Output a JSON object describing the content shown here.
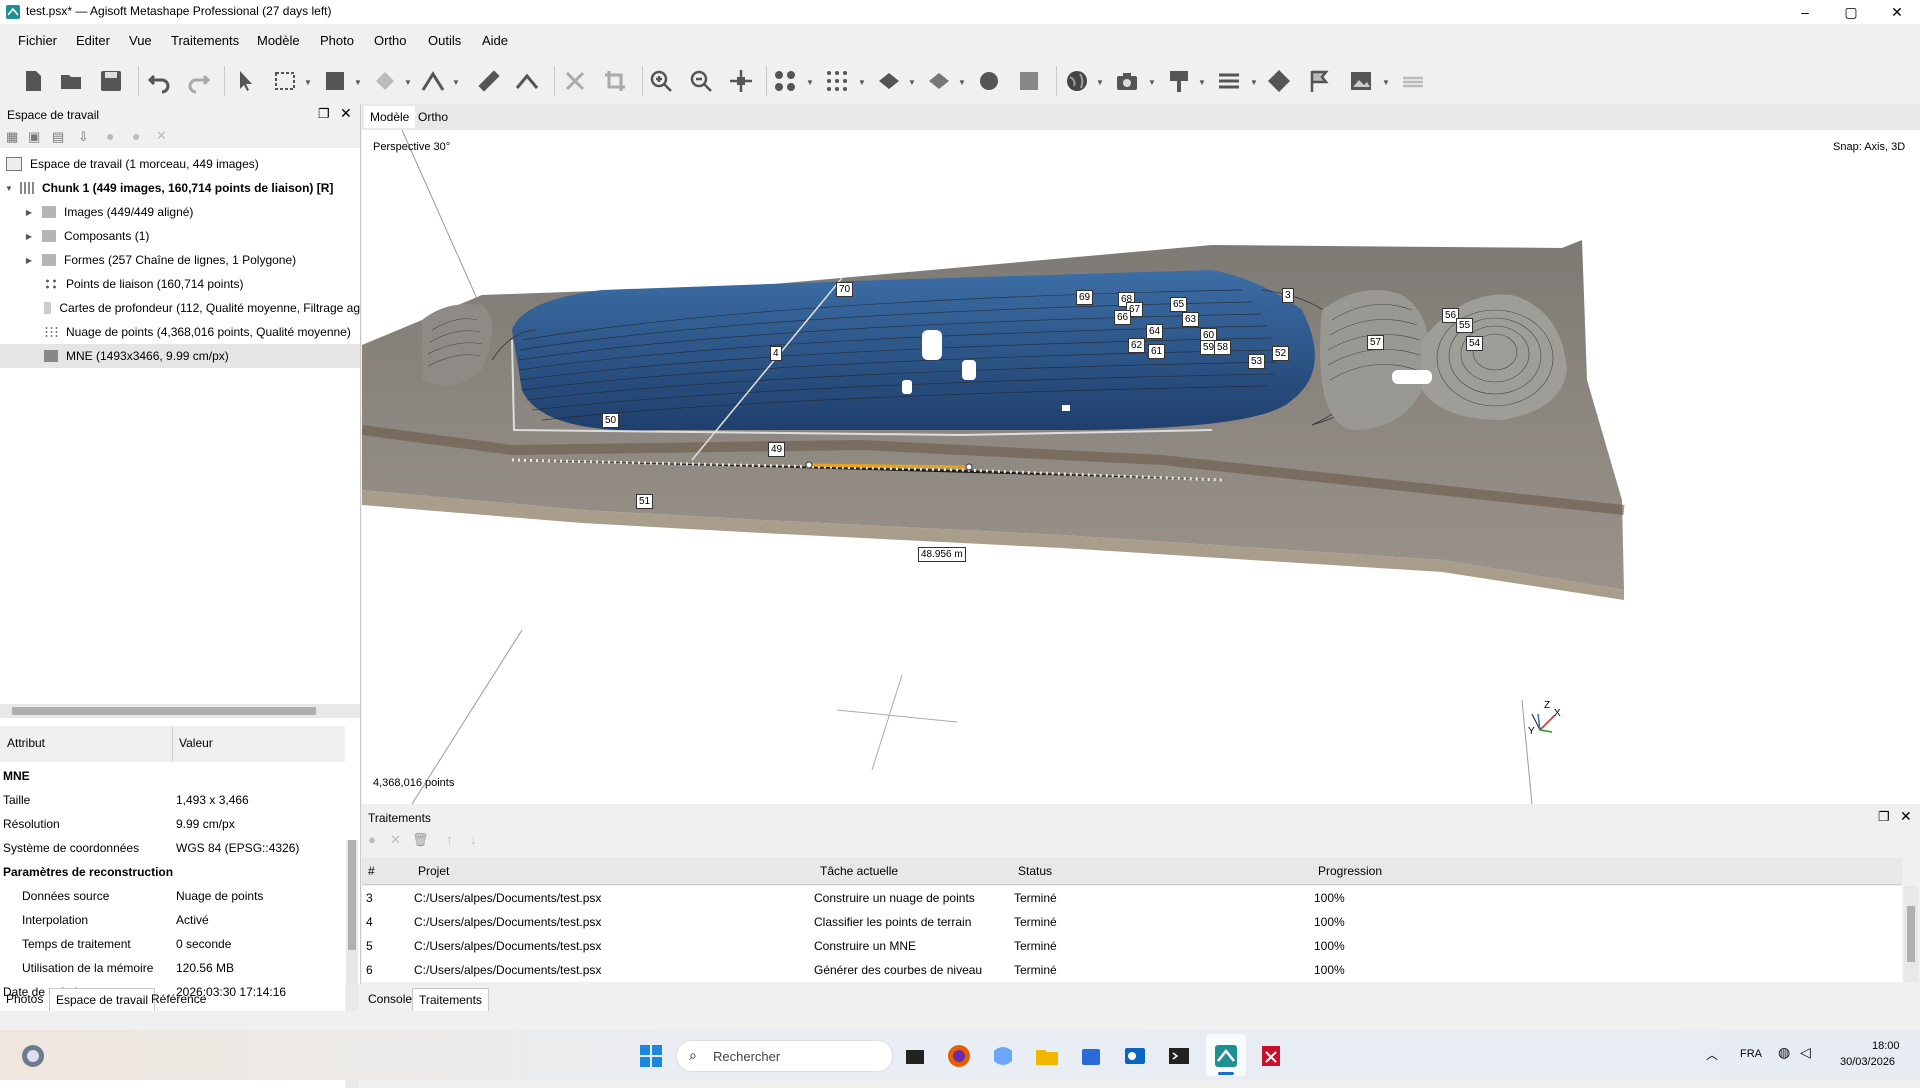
{
  "window": {
    "title": "test.psx* — Agisoft Metashape Professional (27 days left)"
  },
  "menu": [
    "Fichier",
    "Editer",
    "Vue",
    "Traitements",
    "Modèle",
    "Photo",
    "Ortho",
    "Outils",
    "Aide"
  ],
  "workspace": {
    "title": "Espace de travail",
    "root": "Espace de travail (1 morceau, 449 images)",
    "chunk": "Chunk 1 (449 images, 160,714 points de liaison) [R]",
    "items": [
      "Images (449/449 aligné)",
      "Composants (1)",
      "Formes (257 Chaîne de lignes, 1 Polygone)",
      "Points de liaison (160,714 points)",
      "Cartes de profondeur (112, Qualité moyenne, Filtrage ag",
      "Nuage de points (4,368,016 points, Qualité moyenne)",
      "MNE (1493x3466, 9.99 cm/px)"
    ]
  },
  "attributes": {
    "col_attr": "Attribut",
    "col_val": "Valeur",
    "section": "MNE",
    "rows": [
      {
        "k": "Taille",
        "v": "1,493 x 3,466"
      },
      {
        "k": "Résolution",
        "v": "9.99 cm/px"
      },
      {
        "k": "Système de coordonnées",
        "v": "WGS 84 (EPSG::4326)"
      }
    ],
    "section2": "Paramètres de reconstruction",
    "rows2": [
      {
        "k": "Données source",
        "v": "Nuage de points"
      },
      {
        "k": "Interpolation",
        "v": "Activé"
      },
      {
        "k": "Temps de traitement",
        "v": "0 seconde"
      },
      {
        "k": "Utilisation de la mémoire",
        "v": "120.56 MB"
      },
      {
        "k": "Date de création",
        "v": "2026:03:30 17:14:16"
      }
    ]
  },
  "left_tabs": [
    "Photos",
    "Espace de travail",
    "Référence"
  ],
  "view_tabs": [
    "Modèle",
    "Ortho"
  ],
  "viewport": {
    "perspective": "Perspective 30°",
    "snap": "Snap: Axis, 3D",
    "points": "4,368,016 points",
    "measure": "48.956 m",
    "axis_x": "X",
    "axis_y": "Y",
    "axis_z": "Z"
  },
  "contour_labels": [
    "70",
    "69",
    "68",
    "67",
    "66",
    "65",
    "63",
    "64",
    "62",
    "61",
    "60",
    "59",
    "58",
    "57",
    "56",
    "55",
    "54",
    "53",
    "52",
    "51",
    "50",
    "49",
    "4",
    "3"
  ],
  "processing": {
    "title": "Traitements",
    "headers": [
      "#",
      "Projet",
      "Tâche actuelle",
      "Status",
      "Progression"
    ],
    "rows": [
      {
        "n": "3",
        "p": "C:/Users/alpes/Documents/test.psx",
        "t": "Construire un nuage de points",
        "s": "Terminé",
        "g": "100%"
      },
      {
        "n": "4",
        "p": "C:/Users/alpes/Documents/test.psx",
        "t": "Classifier les points de terrain",
        "s": "Terminé",
        "g": "100%"
      },
      {
        "n": "5",
        "p": "C:/Users/alpes/Documents/test.psx",
        "t": "Construire un MNE",
        "s": "Terminé",
        "g": "100%"
      },
      {
        "n": "6",
        "p": "C:/Users/alpes/Documents/test.psx",
        "t": "Générer des courbes de niveau",
        "s": "Terminé",
        "g": "100%"
      }
    ]
  },
  "bottom_tabs": [
    "Console",
    "Traitements"
  ],
  "taskbar": {
    "search": "Rechercher",
    "lang": "FRA",
    "time": "18:00",
    "date": "30/03/2026"
  },
  "colors": {
    "accent": "#2a6fdb",
    "measure_line": "#e8a21c",
    "dem_blue": "#2f5d97"
  }
}
